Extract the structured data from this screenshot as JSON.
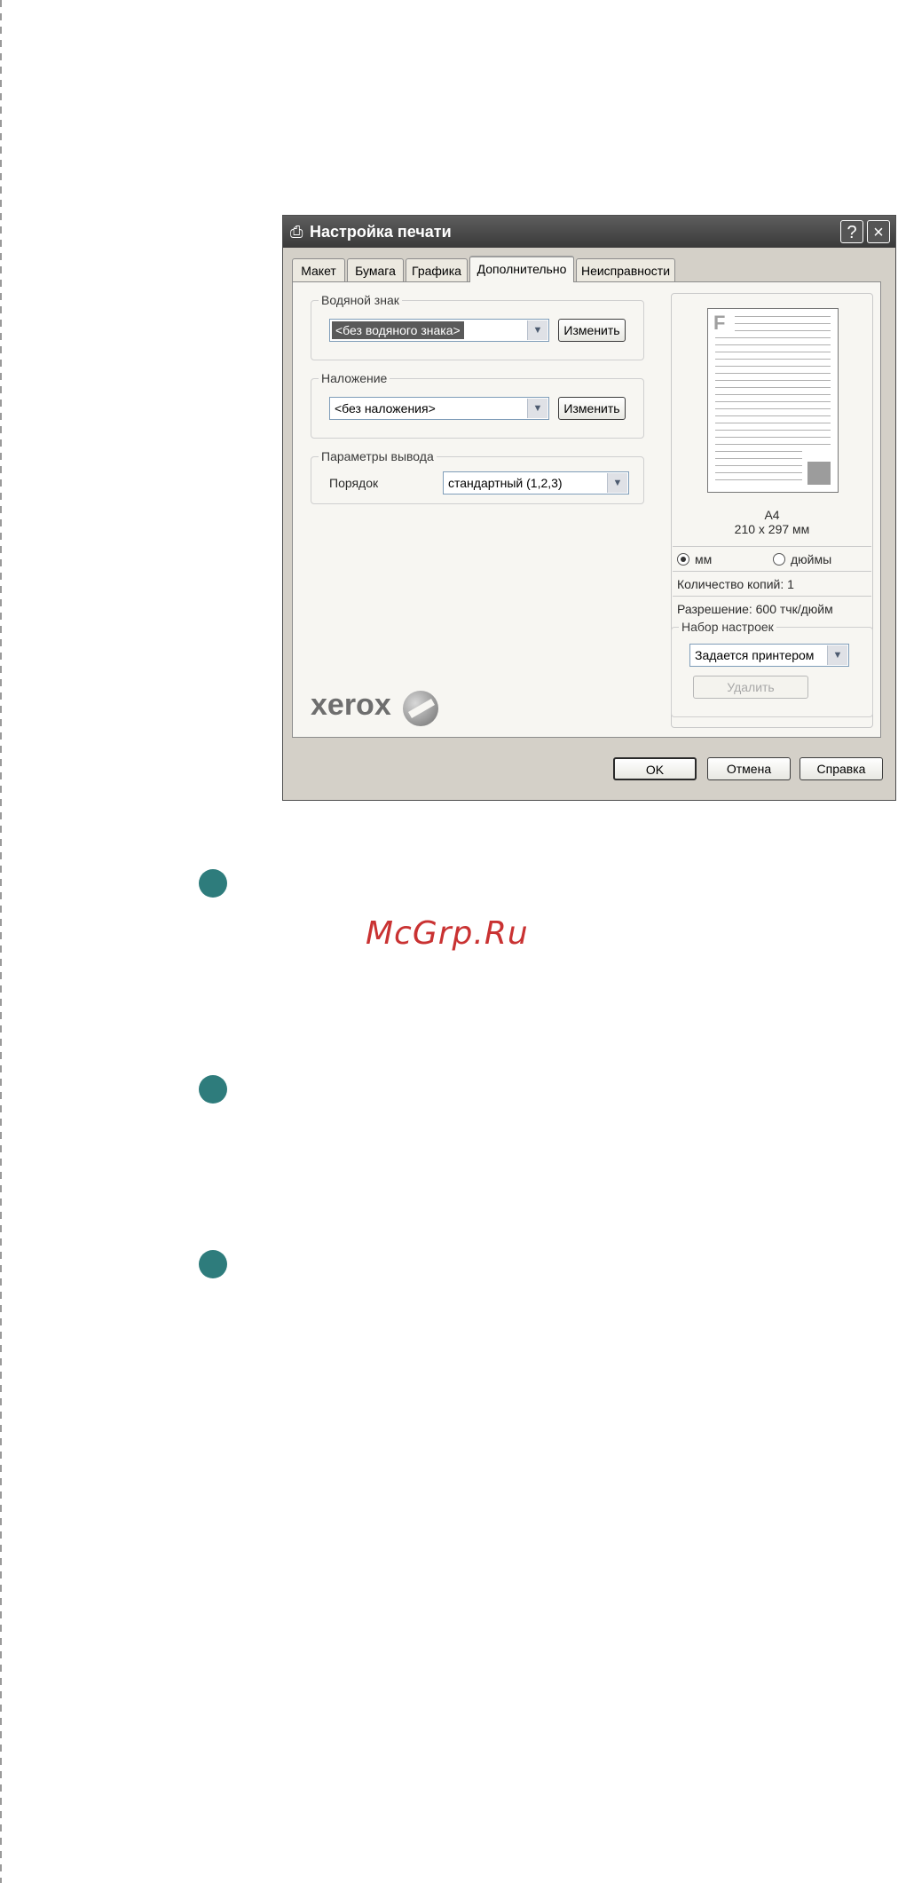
{
  "dialog": {
    "title": "Настройка печати",
    "help_button": "?",
    "close_button": "×"
  },
  "tabs": [
    {
      "label": "Макет"
    },
    {
      "label": "Бумага"
    },
    {
      "label": "Графика"
    },
    {
      "label": "Дополнительно",
      "active": true
    },
    {
      "label": "Неисправности"
    }
  ],
  "watermark_group": {
    "title": "Водяной знак",
    "selected": "<без водяного знака>",
    "edit_button": "Изменить"
  },
  "overlay_group": {
    "title": "Наложение",
    "selected": "<без наложения>",
    "edit_button": "Изменить"
  },
  "output_group": {
    "title": "Параметры вывода",
    "order_label": "Порядок",
    "order_value": "стандартный (1,2,3)"
  },
  "preview": {
    "page_letter": "F",
    "paper_name": "A4",
    "paper_size": "210 x 297 мм",
    "unit_mm": "мм",
    "unit_inches": "дюймы",
    "unit_selected": "мм",
    "copies": "Количество копий: 1",
    "resolution": "Разрешение: 600 тчк/дюйм"
  },
  "presets": {
    "title": "Набор настроек",
    "selected": "Задается принтером",
    "delete_button": "Удалить"
  },
  "brand": {
    "logo_text": "xerox"
  },
  "buttons": {
    "ok": "OK",
    "cancel": "Отмена",
    "help": "Справка"
  },
  "watermark_text": "McGrp.Ru",
  "colors": {
    "marker": "#2e7c7c",
    "watermark": "#c93232"
  }
}
